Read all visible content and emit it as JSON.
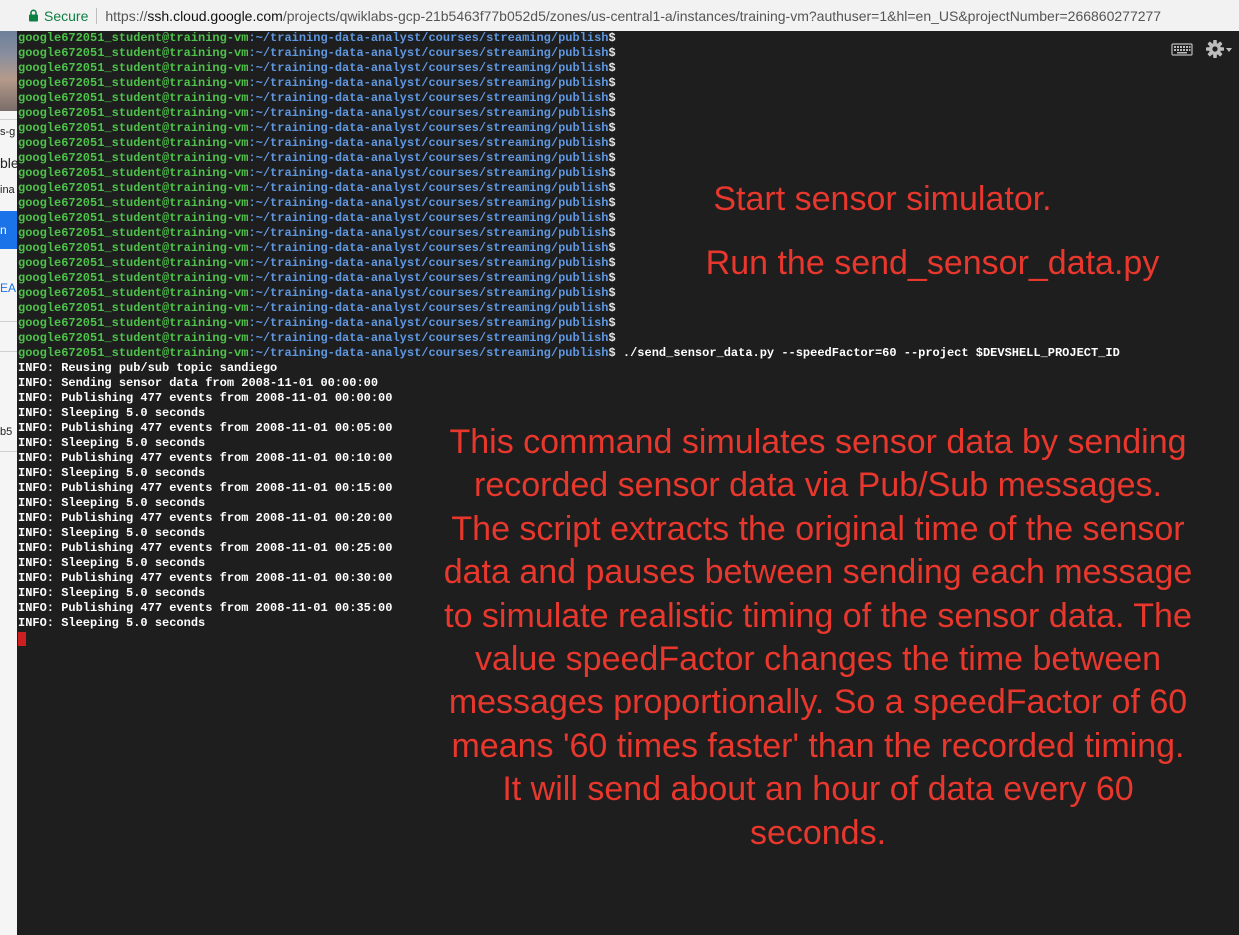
{
  "address_bar": {
    "secure_label": "Secure",
    "url_scheme": "https://",
    "url_host": "ssh.cloud.google.com",
    "url_path": "/projects/qwiklabs-gcp-21b5463f77b052d5/zones/us-central1-a/instances/training-vm?authuser=1&hl=en_US&projectNumber=266860277277"
  },
  "background_window_fragments": [
    "s-g",
    "ble",
    "ina",
    "n",
    "EA",
    "b5"
  ],
  "terminal": {
    "prompt_user": "google672051_student@training-vm",
    "prompt_path": ":~/training-data-analyst/courses/streaming/publish",
    "prompt_symbol": "$",
    "prompt_count": 22,
    "command": " ./send_sensor_data.py --speedFactor=60 --project $DEVSHELL_PROJECT_ID",
    "output": [
      "INFO: Reusing pub/sub topic sandiego",
      "INFO: Sending sensor data from 2008-11-01 00:00:00",
      "INFO: Publishing 477 events from 2008-11-01 00:00:00",
      "INFO: Sleeping 5.0 seconds",
      "INFO: Publishing 477 events from 2008-11-01 00:05:00",
      "INFO: Sleeping 5.0 seconds",
      "INFO: Publishing 477 events from 2008-11-01 00:10:00",
      "INFO: Sleeping 5.0 seconds",
      "INFO: Publishing 477 events from 2008-11-01 00:15:00",
      "INFO: Sleeping 5.0 seconds",
      "INFO: Publishing 477 events from 2008-11-01 00:20:00",
      "INFO: Sleeping 5.0 seconds",
      "INFO: Publishing 477 events from 2008-11-01 00:25:00",
      "INFO: Sleeping 5.0 seconds",
      "INFO: Publishing 477 events from 2008-11-01 00:30:00",
      "INFO: Sleeping 5.0 seconds",
      "INFO: Publishing 477 events from 2008-11-01 00:35:00",
      "INFO: Sleeping 5.0 seconds"
    ],
    "toolbar_icons": [
      "keyboard-icon",
      "gear-icon"
    ]
  },
  "annotations": {
    "start": "Start sensor simulator.",
    "run": "Run the send_sensor_data.py",
    "description": "This command simulates sensor data by sending recorded sensor data via Pub/Sub messages. The script extracts the original time of the sensor data and pauses between sending each message to simulate realistic timing of the sensor data. The value speedFactor changes the time between messages proportionally. So a speedFactor of 60 means '60 times faster' than the recorded timing. It will send about an hour of data every 60 seconds."
  },
  "colors": {
    "terminal_bg": "#1e1e1e",
    "prompt_user": "#4ec24a",
    "prompt_path": "#5f97e0",
    "annotation_red": "#e8372c",
    "cursor": "#cc1f1f",
    "secure_green": "#0b8043"
  }
}
